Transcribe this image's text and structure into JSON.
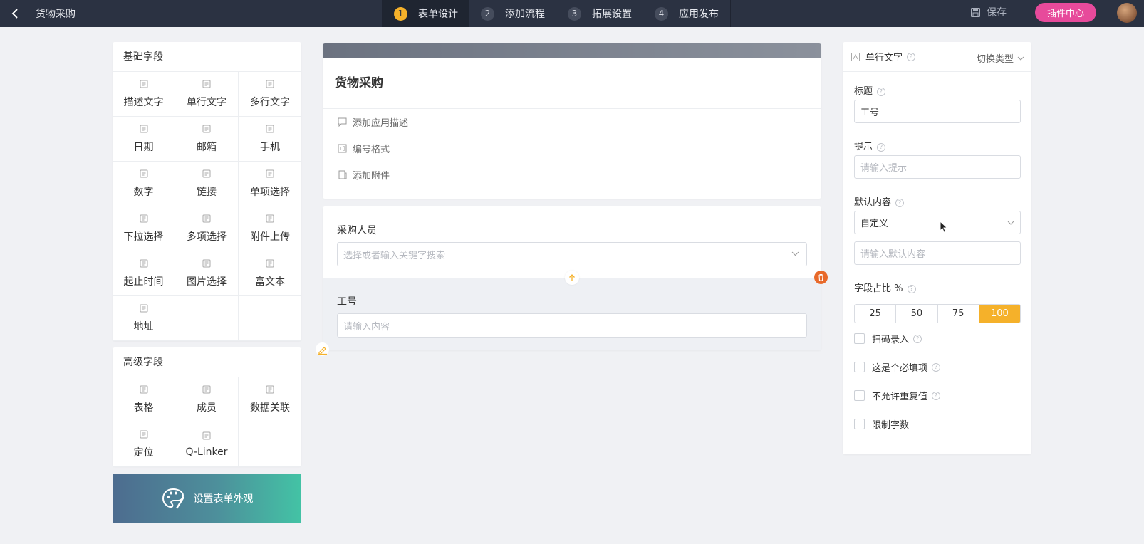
{
  "topbar": {
    "app_title": "货物采购",
    "steps": [
      {
        "num": "1",
        "label": "表单设计",
        "active": true
      },
      {
        "num": "2",
        "label": "添加流程",
        "active": false
      },
      {
        "num": "3",
        "label": "拓展设置",
        "active": false
      },
      {
        "num": "4",
        "label": "应用发布",
        "active": false
      }
    ],
    "save_label": "保存",
    "plugin_label": "插件中心"
  },
  "basic_fields": {
    "title": "基础字段",
    "items": [
      {
        "label": "描述文字",
        "icon": "paragraph-icon"
      },
      {
        "label": "单行文字",
        "icon": "text-icon"
      },
      {
        "label": "多行文字",
        "icon": "textarea-icon"
      },
      {
        "label": "日期",
        "icon": "calendar-icon"
      },
      {
        "label": "邮箱",
        "icon": "mail-icon"
      },
      {
        "label": "手机",
        "icon": "phone-icon"
      },
      {
        "label": "数字",
        "icon": "number-icon"
      },
      {
        "label": "链接",
        "icon": "link-icon"
      },
      {
        "label": "单项选择",
        "icon": "radio-icon"
      },
      {
        "label": "下拉选择",
        "icon": "dropdown-icon"
      },
      {
        "label": "多项选择",
        "icon": "checkbox-icon"
      },
      {
        "label": "附件上传",
        "icon": "attachment-icon"
      },
      {
        "label": "起止时间",
        "icon": "time-range-icon"
      },
      {
        "label": "图片选择",
        "icon": "image-icon"
      },
      {
        "label": "富文本",
        "icon": "rich-text-icon"
      },
      {
        "label": "地址",
        "icon": "location-pin-icon"
      }
    ]
  },
  "advanced_fields": {
    "title": "高级字段",
    "items": [
      {
        "label": "表格",
        "icon": "table-icon"
      },
      {
        "label": "成员",
        "icon": "member-icon"
      },
      {
        "label": "数据关联",
        "icon": "data-link-icon"
      },
      {
        "label": "定位",
        "icon": "locate-icon"
      },
      {
        "label": "Q-Linker",
        "icon": "share-nodes-icon"
      }
    ]
  },
  "appearance_label": "设置表单外观",
  "form": {
    "title": "货物采购",
    "options": [
      {
        "label": "添加应用描述",
        "icon": "comment-icon"
      },
      {
        "label": "编号格式",
        "icon": "numbering-icon"
      },
      {
        "label": "添加附件",
        "icon": "attachment-icon"
      }
    ],
    "fields": [
      {
        "label": "采购人员",
        "placeholder": "选择或者输入关键字搜索"
      },
      {
        "label": "工号",
        "placeholder": "请输入内容"
      }
    ]
  },
  "props": {
    "type_label": "单行文字",
    "switch_label": "切换类型",
    "title_label": "标题",
    "title_value": "工号",
    "hint_label": "提示",
    "hint_placeholder": "请输入提示",
    "default_label": "默认内容",
    "default_select": "自定义",
    "default_placeholder": "请输入默认内容",
    "ratio_label": "字段占比 %",
    "ratio_options": [
      "25",
      "50",
      "75",
      "100"
    ],
    "ratio_selected": "100",
    "checks": [
      "扫码录入",
      "这是个必填项",
      "不允许重复值",
      "限制字数"
    ]
  },
  "colors": {
    "topbar": "#2b3242",
    "accent": "#f5b12a",
    "plugin": "#e74a9b",
    "delete": "#e8692a"
  }
}
